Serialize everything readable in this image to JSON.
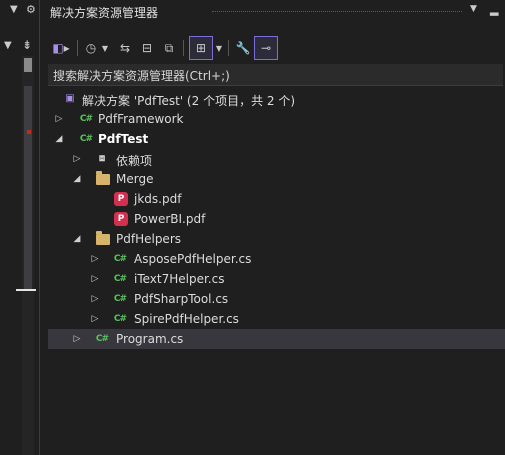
{
  "panel": {
    "title": "解决方案资源管理器"
  },
  "search": {
    "placeholder": "搜索解决方案资源管理器(Ctrl+;)"
  },
  "tree": {
    "solution": "解决方案 'PdfTest' (2 个项目，共 2 个)",
    "items": [
      {
        "label": "PdfFramework",
        "icon": "csharp-project-icon"
      },
      {
        "label": "PdfTest",
        "icon": "csharp-project-icon"
      },
      {
        "label": "依赖项",
        "icon": "dependencies-icon"
      },
      {
        "label": "Merge",
        "icon": "folder-icon"
      },
      {
        "label": "jkds.pdf",
        "icon": "pdf-file-icon"
      },
      {
        "label": "PowerBI.pdf",
        "icon": "pdf-file-icon"
      },
      {
        "label": "PdfHelpers",
        "icon": "folder-icon"
      },
      {
        "label": "AsposePdfHelper.cs",
        "icon": "csharp-file-icon"
      },
      {
        "label": "iText7Helper.cs",
        "icon": "csharp-file-icon"
      },
      {
        "label": "PdfSharpTool.cs",
        "icon": "csharp-file-icon"
      },
      {
        "label": "SpirePdfHelper.cs",
        "icon": "csharp-file-icon"
      },
      {
        "label": "Program.cs",
        "icon": "csharp-file-icon"
      }
    ]
  },
  "icons": {
    "csharp": "C#",
    "pdf": "P"
  },
  "colors": {
    "accent": "#7d6cd9",
    "csharp": "#57c35a",
    "pdf": "#d32f4f",
    "folder": "#d6b46a",
    "selected_row": "#37373d"
  }
}
